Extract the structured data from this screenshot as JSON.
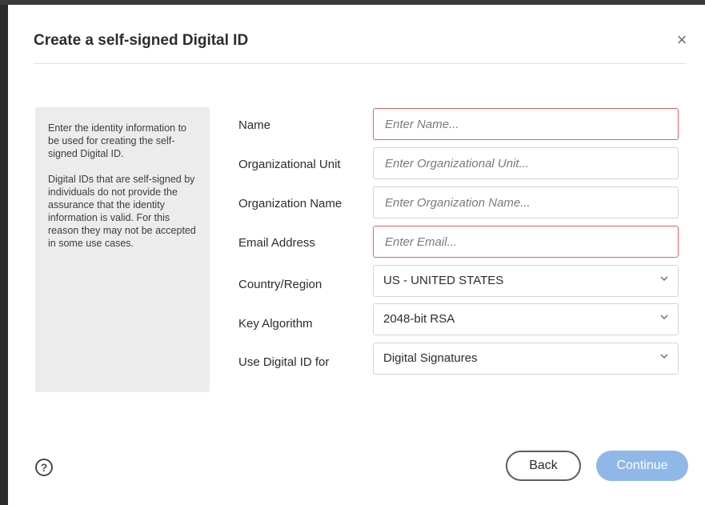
{
  "dialog": {
    "title": "Create a self-signed Digital ID",
    "close_icon": "×"
  },
  "info": {
    "paragraph1": "Enter the identity information to be used for creating the self-signed Digital ID.",
    "paragraph2": "Digital IDs that are self-signed by individuals do not provide the assurance that the identity information is valid. For this reason they may not be accepted in some use cases."
  },
  "form": {
    "name": {
      "label": "Name",
      "placeholder": "Enter Name...",
      "value": ""
    },
    "org_unit": {
      "label": "Organizational Unit",
      "placeholder": "Enter Organizational Unit...",
      "value": ""
    },
    "org_name": {
      "label": "Organization Name",
      "placeholder": "Enter Organization Name...",
      "value": ""
    },
    "email": {
      "label": "Email Address",
      "placeholder": "Enter Email...",
      "value": ""
    },
    "country": {
      "label": "Country/Region",
      "value": "US - UNITED STATES"
    },
    "key_algorithm": {
      "label": "Key Algorithm",
      "value": "2048-bit RSA"
    },
    "use_for": {
      "label": "Use Digital ID for",
      "value": "Digital Signatures"
    }
  },
  "footer": {
    "help_icon": "?",
    "back_label": "Back",
    "continue_label": "Continue"
  },
  "colors": {
    "error_border": "#e06363",
    "continue_disabled": "#8fb8e8"
  }
}
